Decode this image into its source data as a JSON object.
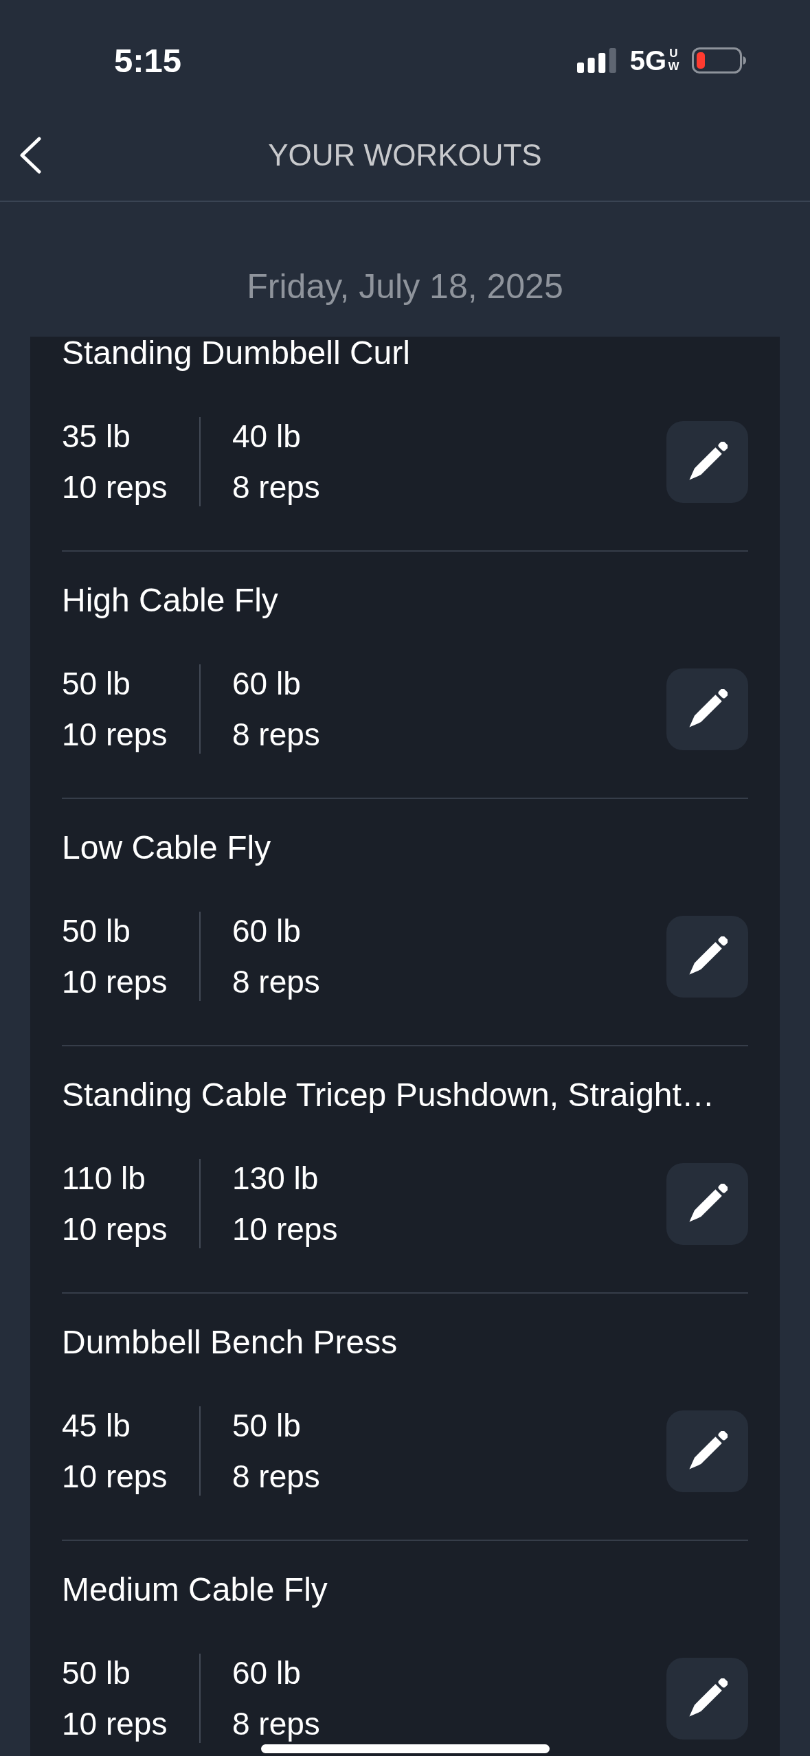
{
  "status_bar": {
    "time": "5:15",
    "network": "5G",
    "network_tag": "UW"
  },
  "header": {
    "title": "YOUR WORKOUTS"
  },
  "date": "Friday, July 18, 2025",
  "exercises": [
    {
      "name": "Standing Dumbbell Curl",
      "sets": [
        {
          "weight": "35 lb",
          "reps": "10 reps"
        },
        {
          "weight": "40 lb",
          "reps": "8 reps"
        }
      ]
    },
    {
      "name": "High Cable Fly",
      "sets": [
        {
          "weight": "50 lb",
          "reps": "10 reps"
        },
        {
          "weight": "60 lb",
          "reps": "8 reps"
        }
      ]
    },
    {
      "name": "Low Cable Fly",
      "sets": [
        {
          "weight": "50 lb",
          "reps": "10 reps"
        },
        {
          "weight": "60 lb",
          "reps": "8 reps"
        }
      ]
    },
    {
      "name": "Standing Cable Tricep Pushdown, Straight…",
      "sets": [
        {
          "weight": "110 lb",
          "reps": "10 reps"
        },
        {
          "weight": "130 lb",
          "reps": "10 reps"
        }
      ]
    },
    {
      "name": "Dumbbell Bench Press",
      "sets": [
        {
          "weight": "45 lb",
          "reps": "10 reps"
        },
        {
          "weight": "50 lb",
          "reps": "8 reps"
        }
      ]
    },
    {
      "name": "Medium Cable Fly",
      "sets": [
        {
          "weight": "50 lb",
          "reps": "10 reps"
        },
        {
          "weight": "60 lb",
          "reps": "8 reps"
        }
      ]
    }
  ]
}
